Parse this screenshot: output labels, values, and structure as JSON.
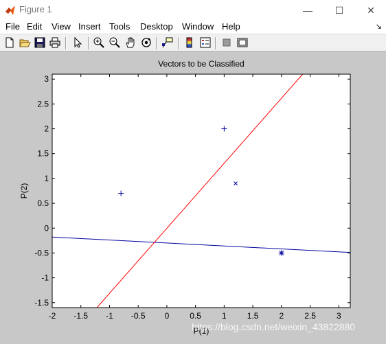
{
  "window": {
    "title": "Figure 1",
    "minimize": "—",
    "maximize": "☐",
    "close": "✕"
  },
  "menu": {
    "items": [
      "File",
      "Edit",
      "View",
      "Insert",
      "Tools",
      "Desktop",
      "Window",
      "Help"
    ],
    "overflow": "↘"
  },
  "toolbar": {
    "icons": [
      "new-figure-icon",
      "open-file-icon",
      "save-icon",
      "print-icon",
      "edit-plot-arrow-icon",
      "zoom-in-icon",
      "zoom-out-icon",
      "pan-hand-icon",
      "rotate-3d-icon",
      "data-cursor-icon",
      "colorbar-icon",
      "legend-icon",
      "hide-plot-tools-icon",
      "show-plot-tools-icon"
    ]
  },
  "watermark": "https://blog.csdn.net/weixin_43822880",
  "chart_data": {
    "type": "scatter",
    "title": "Vectors to be Classified",
    "xlabel": "P(1)",
    "ylabel": "P(2)",
    "xlim": [
      -2,
      3.2
    ],
    "ylim": [
      -1.6,
      3.1
    ],
    "xticks": [
      "-2",
      "-1.5",
      "-1",
      "-0.5",
      "0",
      "0.5",
      "1",
      "1.5",
      "2",
      "2.5",
      "3"
    ],
    "yticks": [
      "-1.5",
      "-1",
      "-0.5",
      "0",
      "0.5",
      "1",
      "1.5",
      "2",
      "2.5",
      "3"
    ],
    "grid": false,
    "points": [
      {
        "x": -0.8,
        "y": 0.7,
        "marker": "+"
      },
      {
        "x": 1.0,
        "y": 2.0,
        "marker": "+"
      },
      {
        "x": 2.0,
        "y": -0.5,
        "marker": "+"
      },
      {
        "x": 2.0,
        "y": -0.5,
        "marker": "*"
      },
      {
        "x": 1.2,
        "y": 0.9,
        "marker": "x"
      }
    ],
    "lines": [
      {
        "color": "#0000a0",
        "from": [
          -2,
          -0.18
        ],
        "to": [
          3.2,
          -0.49
        ]
      },
      {
        "color": "#ff0000",
        "from": [
          -1.22,
          -1.6
        ],
        "to": [
          2.37,
          3.1
        ]
      }
    ],
    "marker_color": "#0000a0"
  }
}
